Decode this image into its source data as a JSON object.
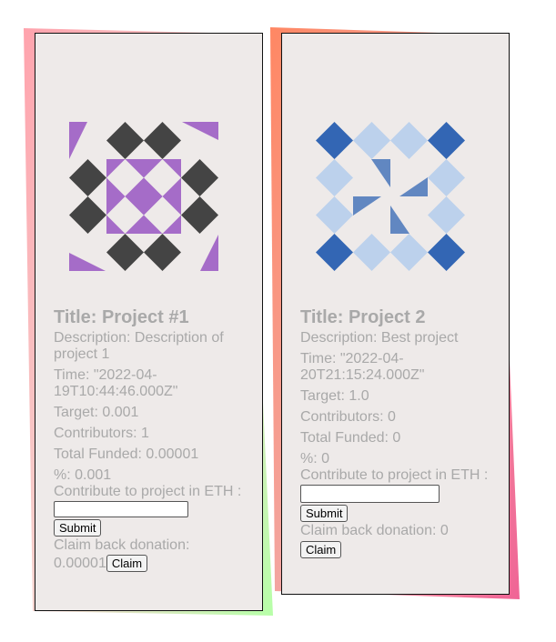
{
  "projects": [
    {
      "title": "Title: Project #1",
      "description": "Description: Description of project 1",
      "time": "Time: \"2022-04-19T10:44:46.000Z\"",
      "target": "Target: 0.001",
      "contributors": "Contributors: 1",
      "total_funded": "Total Funded: 0.00001",
      "percent": "%: 0.001",
      "contribute_label": "Contribute to project in ETH :",
      "contribute_value": "",
      "submit_label": "Submit",
      "claim_back_label": "Claim back donation:",
      "claim_back_value": "0.00001",
      "claim_label": "Claim",
      "identicon_color": "#a56cc8",
      "identicon_dark": "#444444",
      "frame_colors": [
        "#ffa3ad",
        "#b7ffa8"
      ]
    },
    {
      "title": "Title: Project 2",
      "description": "Description: Best project",
      "time": "Time: \"2022-04-20T21:15:24.000Z\"",
      "target": "Target: 1.0",
      "contributors": "Contributors: 0",
      "total_funded": "Total Funded: 0",
      "percent": "%: 0",
      "contribute_label": "Contribute to project in ETH :",
      "contribute_value": "",
      "submit_label": "Submit",
      "claim_back_label": "Claim back donation: 0",
      "claim_label": "Claim",
      "identicon_color": "#3366b4",
      "identicon_light": "#bcd1ec",
      "frame_colors": [
        "#ff8763",
        "#f06496"
      ]
    }
  ]
}
